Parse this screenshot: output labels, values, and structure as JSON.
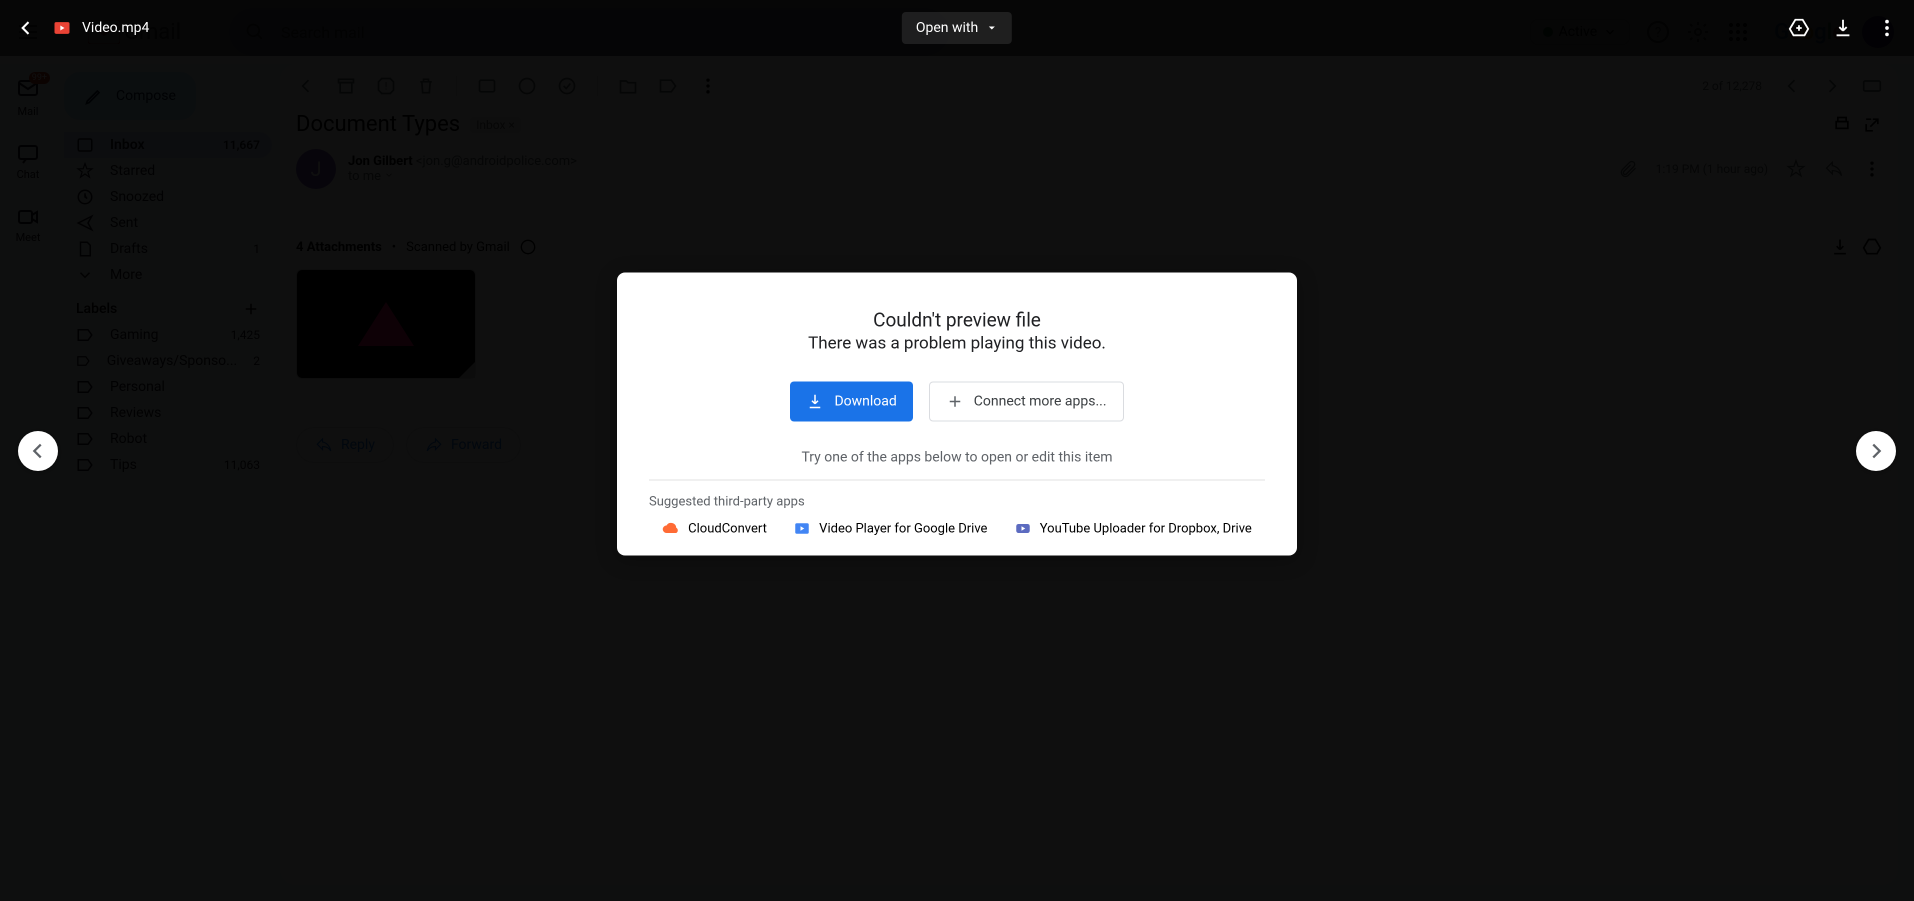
{
  "viewer": {
    "filename": "Video.mp4",
    "open_with": "Open with",
    "prev_tooltip": "Previous",
    "next_tooltip": "Next"
  },
  "preview_modal": {
    "title": "Couldn't preview file",
    "subtitle": "There was a problem playing this video.",
    "download_label": "Download",
    "connect_label": "Connect more apps...",
    "hint": "Try one of the apps below to open or edit this item",
    "apps_header": "Suggested third-party apps",
    "apps": [
      {
        "name": "CloudConvert",
        "icon": "cloud-convert-icon"
      },
      {
        "name": "Video Player for Google Drive",
        "icon": "drive-video-icon"
      },
      {
        "name": "YouTube Uploader for Dropbox, Drive",
        "icon": "youtube-uploader-icon"
      }
    ]
  },
  "gmail": {
    "logo_text": "Gmail",
    "search_placeholder": "Search mail",
    "status": "Active",
    "google_brand": "Google",
    "nav": {
      "mail": "Mail",
      "mail_badge": "99+",
      "chat": "Chat",
      "meet": "Meet"
    },
    "compose": "Compose",
    "sidebar": [
      {
        "label": "Inbox",
        "count": "11,667",
        "active": true
      },
      {
        "label": "Starred"
      },
      {
        "label": "Snoozed"
      },
      {
        "label": "Sent"
      },
      {
        "label": "Drafts",
        "count": "1"
      },
      {
        "label": "More"
      }
    ],
    "labels_header": "Labels",
    "labels": [
      {
        "label": "Gaming",
        "count": "1,425"
      },
      {
        "label": "Giveaways/Sponso...",
        "count": "2"
      },
      {
        "label": "Personal"
      },
      {
        "label": "Reviews"
      },
      {
        "label": "Robot"
      },
      {
        "label": "Tips",
        "count": "11,063"
      }
    ],
    "pager": "2 of 12,278",
    "subject": "Document Types",
    "inbox_chip": "Inbox",
    "sender_name": "Jon Gilbert",
    "sender_addr": "<jon.g@androidpolice.com>",
    "recipient": "to me",
    "timestamp": "1:19 PM (1 hour ago)",
    "attachment_line": "4 Attachments",
    "scanned": "Scanned by Gmail",
    "reply": "Reply",
    "forward": "Forward"
  }
}
